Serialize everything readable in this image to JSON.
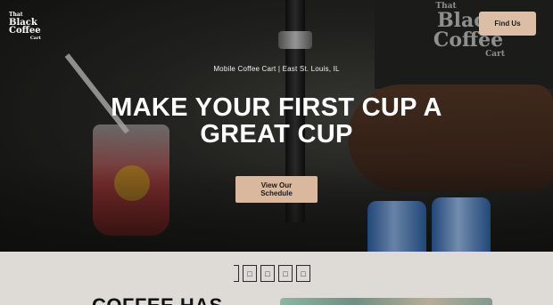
{
  "header": {
    "logo": {
      "line1": "That",
      "line2": "Black",
      "line3": "Coffee",
      "line4": "Cart"
    },
    "find_us_label": "Find Us"
  },
  "hero": {
    "eyebrow": "Mobile Coffee Cart | East St. Louis, IL",
    "headline_line1": "MAKE YOUR FIRST CUP A",
    "headline_line2": "GREAT CUP",
    "cta_line1": "View Our",
    "cta_line2": "Schedule",
    "shirt_print": {
      "line1": "That",
      "line2": "Black",
      "line3": "Coffee",
      "line4": "Cart"
    }
  },
  "lower": {
    "glyphs": [
      "□",
      "□",
      "□",
      "□",
      "□"
    ],
    "section_heading": "COFFEE HAS"
  },
  "colors": {
    "button_tan": "#dcbea6",
    "cta_tan": "#d9b89d",
    "lower_bg": "#dedbd6"
  }
}
